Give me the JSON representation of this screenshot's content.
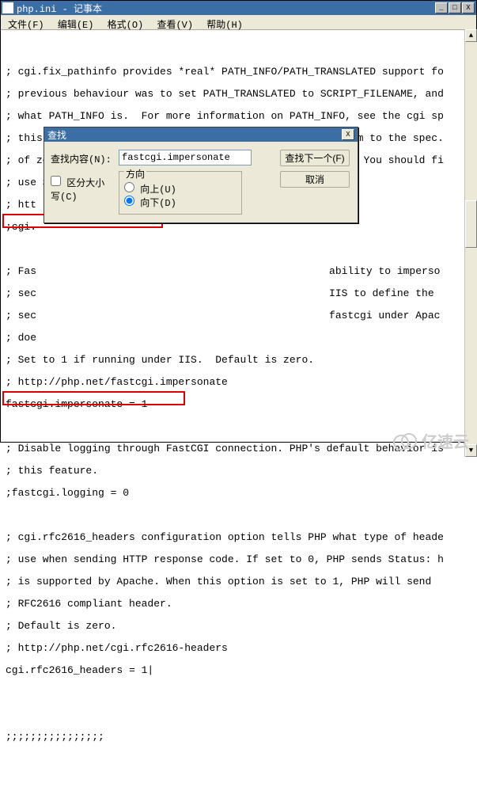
{
  "window": {
    "title": "php.ini - 记事本",
    "buttons": {
      "min": "_",
      "max": "□",
      "close": "X"
    }
  },
  "menu": {
    "file": "文件(F)",
    "edit": "编辑(E)",
    "format": "格式(O)",
    "view": "查看(V)",
    "help": "帮助(H)"
  },
  "lines": {
    "l1": "",
    "l2": "; cgi.fix_pathinfo provides *real* PATH_INFO/PATH_TRANSLATED support fo",
    "l3": "; previous behaviour was to set PATH_TRANSLATED to SCRIPT_FILENAME, and",
    "l4": "; what PATH_INFO is.  For more information on PATH_INFO, see the cgi sp",
    "l5": "; this to 1 will cause PHP CGI to fix its paths to conform to the spec.",
    "l6": "; of zero causes PHP to behave as before.  Default is 1.  You should fi",
    "l7": "; use SCRIPT_FILENAME rather than PATH_TRANSLATED.",
    "l8": "; htt",
    "l9": ";cgi.",
    "l10": "",
    "l11": "; Fas",
    "l12": "; sec",
    "l13": "; sec",
    "l14": "; doe",
    "l8b": "ability to imperso",
    "l9b": "IIS to define the",
    "l10b": "fastcgi under Apac",
    "l15": "; Set to 1 if running under IIS.  Default is zero.",
    "l16": "; http://php.net/fastcgi.impersonate",
    "l17": "fastcgi.impersonate = 1",
    "l18": "",
    "l19": "; Disable logging through FastCGI connection. PHP's default behavior is",
    "l20": "; this feature.",
    "l21": ";fastcgi.logging = 0",
    "l22": "",
    "l23": "; cgi.rfc2616_headers configuration option tells PHP what type of heade",
    "l24": "; use when sending HTTP response code. If set to 0, PHP sends Status: h",
    "l25": "; is supported by Apache. When this option is set to 1, PHP will send",
    "l26": "; RFC2616 compliant header.",
    "l27": "; Default is zero.",
    "l28": "; http://php.net/cgi.rfc2616-headers",
    "l29": "cgi.rfc2616_headers = 1|",
    "l30": "",
    "l31": "",
    "l32": ";;;;;;;;;;;;;;;;"
  },
  "dialog": {
    "title": "查找",
    "close": "X",
    "find_label": "查找内容(N):",
    "find_value": "fastcgi.impersonate",
    "find_next": "查找下一个(F)",
    "cancel": "取消",
    "direction_legend": "方向",
    "up": "向上(U)",
    "down": "向下(D)",
    "match_case": "区分大小写(C)"
  },
  "watermark": "亿速云"
}
